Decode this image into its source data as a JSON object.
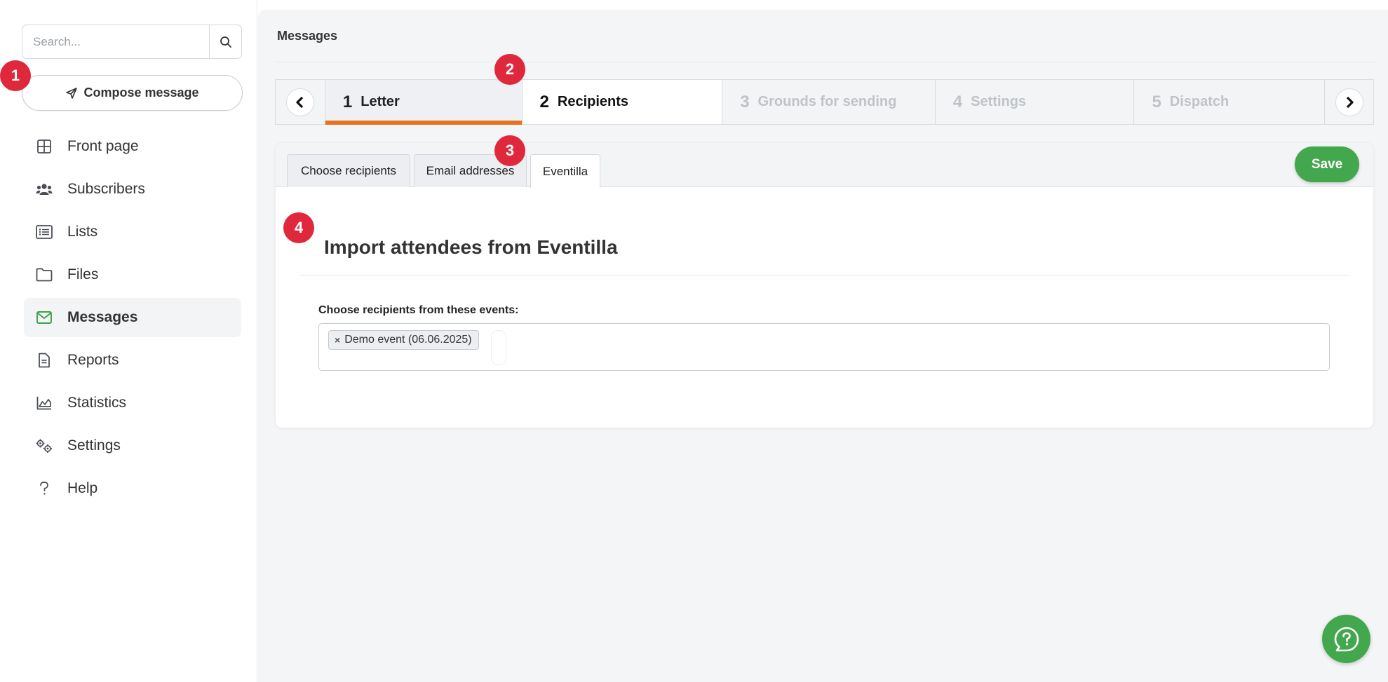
{
  "sidebar": {
    "search": {
      "placeholder": "Search..."
    },
    "compose_label": "Compose message",
    "items": [
      {
        "label": "Front page",
        "icon": "grid-icon",
        "active": false
      },
      {
        "label": "Subscribers",
        "icon": "users-icon",
        "active": false
      },
      {
        "label": "Lists",
        "icon": "list-icon",
        "active": false
      },
      {
        "label": "Files",
        "icon": "folder-icon",
        "active": false
      },
      {
        "label": "Messages",
        "icon": "envelope-icon",
        "active": true
      },
      {
        "label": "Reports",
        "icon": "document-icon",
        "active": false
      },
      {
        "label": "Statistics",
        "icon": "chart-icon",
        "active": false
      },
      {
        "label": "Settings",
        "icon": "gears-icon",
        "active": false
      },
      {
        "label": "Help",
        "icon": "question-icon",
        "active": false
      }
    ]
  },
  "header": {
    "title": "Messages"
  },
  "steps": [
    {
      "num": "1",
      "label": "Letter",
      "state": "done"
    },
    {
      "num": "2",
      "label": "Recipients",
      "state": "current"
    },
    {
      "num": "3",
      "label": "Grounds for sending",
      "state": "disabled"
    },
    {
      "num": "4",
      "label": "Settings",
      "state": "disabled"
    },
    {
      "num": "5",
      "label": "Dispatch",
      "state": "disabled"
    }
  ],
  "tabs": [
    {
      "label": "Choose recipients",
      "active": false
    },
    {
      "label": "Email addresses",
      "active": false
    },
    {
      "label": "Eventilla",
      "active": true
    }
  ],
  "save_label": "Save",
  "section": {
    "title": "Import attendees from Eventilla",
    "field_label": "Choose recipients from these events:",
    "selected": [
      "Demo event (06.06.2025)"
    ],
    "remove_glyph": "×"
  },
  "badges": [
    "1",
    "2",
    "3",
    "4"
  ],
  "colors": {
    "accent_green": "#43a74d",
    "step_underline": "#e8711f",
    "badge_red": "#e0283d"
  }
}
